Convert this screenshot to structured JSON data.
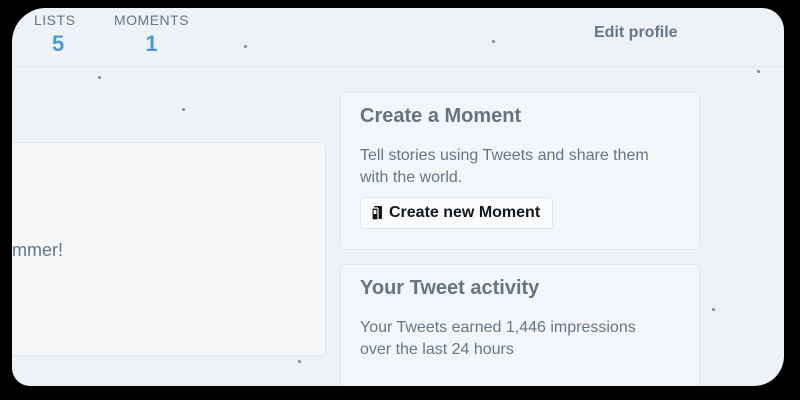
{
  "profile_stats": {
    "lists": {
      "label": "LISTS",
      "value": "5"
    },
    "moments": {
      "label": "MOMENTS",
      "value": "1"
    }
  },
  "edit_profile_label": "Edit profile",
  "left_card": {
    "snippet": "mmer!"
  },
  "create_moment": {
    "title": "Create a Moment",
    "description": "Tell stories using Tweets and share them with the world.",
    "button_label": "Create new Moment",
    "button_icon": "moment-icon"
  },
  "tweet_activity": {
    "title": "Your Tweet activity",
    "description": "Your Tweets earned 1,446 impressions over the last 24 hours"
  },
  "colors": {
    "accent": "#4a99d0",
    "secondary_text": "#657786",
    "primary_text": "#14171a",
    "background": "#eef2f5"
  }
}
